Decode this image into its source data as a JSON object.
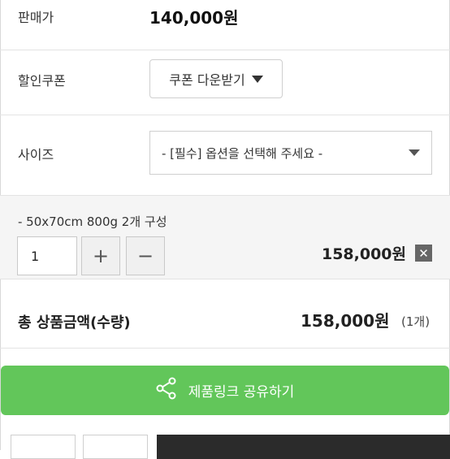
{
  "price": {
    "label": "판매가",
    "value": "140,000원"
  },
  "coupon": {
    "label": "할인쿠폰",
    "button_label": "쿠폰 다운받기"
  },
  "size": {
    "label": "사이즈",
    "selected": "- [필수] 옵션을 선택해 주세요 -"
  },
  "option": {
    "name": "- 50x70cm 800g 2개 구성",
    "quantity": "1",
    "plus": "+",
    "minus": "−",
    "price": "158,000원",
    "remove": "✕"
  },
  "total": {
    "label": "총 상품금액(수량)",
    "price": "158,000원",
    "count": "(1개)"
  },
  "share": {
    "label": "제품링크 공유하기"
  },
  "colors": {
    "share_green": "#62c65a",
    "dark_button": "#2b2b2b"
  },
  "icons": {
    "share": "share-icon",
    "dropdown": "triangle-down-icon"
  }
}
